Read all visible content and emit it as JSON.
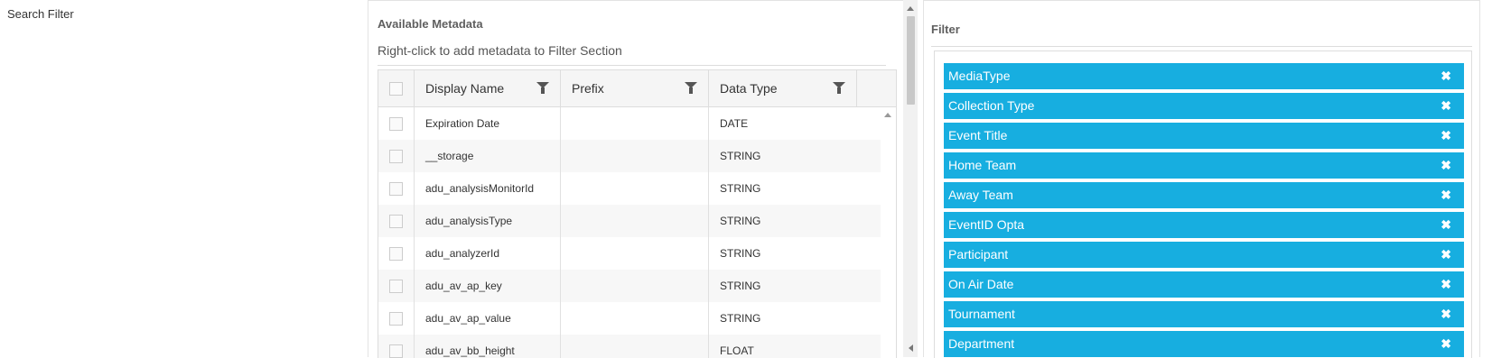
{
  "page": {
    "label": "Search Filter"
  },
  "metadata_panel": {
    "title": "Available Metadata",
    "hint": "Right-click to add metadata to Filter Section",
    "columns": [
      "Display Name",
      "Prefix",
      "Data Type"
    ],
    "rows": [
      {
        "name": "Expiration Date",
        "prefix": "",
        "type": "DATE"
      },
      {
        "name": "__storage",
        "prefix": "",
        "type": "STRING"
      },
      {
        "name": "adu_analysisMonitorId",
        "prefix": "",
        "type": "STRING"
      },
      {
        "name": "adu_analysisType",
        "prefix": "",
        "type": "STRING"
      },
      {
        "name": "adu_analyzerId",
        "prefix": "",
        "type": "STRING"
      },
      {
        "name": "adu_av_ap_key",
        "prefix": "",
        "type": "STRING"
      },
      {
        "name": "adu_av_ap_value",
        "prefix": "",
        "type": "STRING"
      },
      {
        "name": "adu_av_bb_height",
        "prefix": "",
        "type": "FLOAT"
      }
    ]
  },
  "filter_panel": {
    "title": "Filter",
    "chips": [
      "MediaType",
      "Collection Type",
      "Event Title",
      "Home Team",
      "Away Team",
      "EventID Opta",
      "Participant",
      "On Air Date",
      "Tournament",
      "Department"
    ],
    "remove_glyph": "✖"
  },
  "colors": {
    "chip_bg": "#17aee0",
    "header_bg": "#f5f5f5",
    "row_alt": "#f7f7f7"
  }
}
